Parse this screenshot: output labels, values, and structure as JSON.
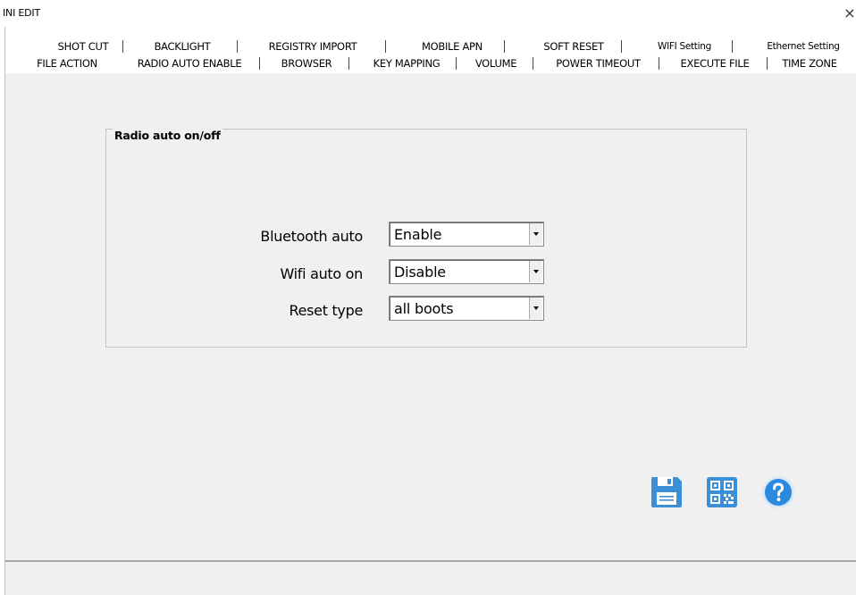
{
  "window": {
    "title": "INI EDIT",
    "close_glyph": "×"
  },
  "tabs": {
    "row1": [
      "SHOT CUT",
      "BACKLIGHT",
      "REGISTRY IMPORT",
      "MOBILE APN",
      "SOFT RESET",
      "WIFI Setting",
      "Ethernet Setting"
    ],
    "row2": [
      "FILE ACTION",
      "RADIO AUTO ENABLE",
      "BROWSER",
      "KEY MAPPING",
      "VOLUME",
      "POWER TIMEOUT",
      "EXECUTE FILE",
      "TIME ZONE"
    ],
    "selected": "RADIO AUTO ENABLE"
  },
  "group": {
    "title": "Radio auto on/off",
    "fields": [
      {
        "label": "Bluetooth auto",
        "value": "Enable"
      },
      {
        "label": "Wifi auto on",
        "value": "Disable"
      },
      {
        "label": "Reset type",
        "value": "all boots"
      }
    ]
  },
  "buttons": [
    {
      "name": "save-button",
      "icon": "floppy-disk-icon",
      "color": "#3a8fd6"
    },
    {
      "name": "qr-code-button",
      "icon": "qr-code-icon",
      "color": "#3a8fd6"
    },
    {
      "name": "help-button",
      "icon": "question-mark-icon",
      "color": "#2b8ae0"
    }
  ],
  "colors": {
    "panel_bg": "#f0f0f0",
    "accent": "#3a8fd6"
  }
}
